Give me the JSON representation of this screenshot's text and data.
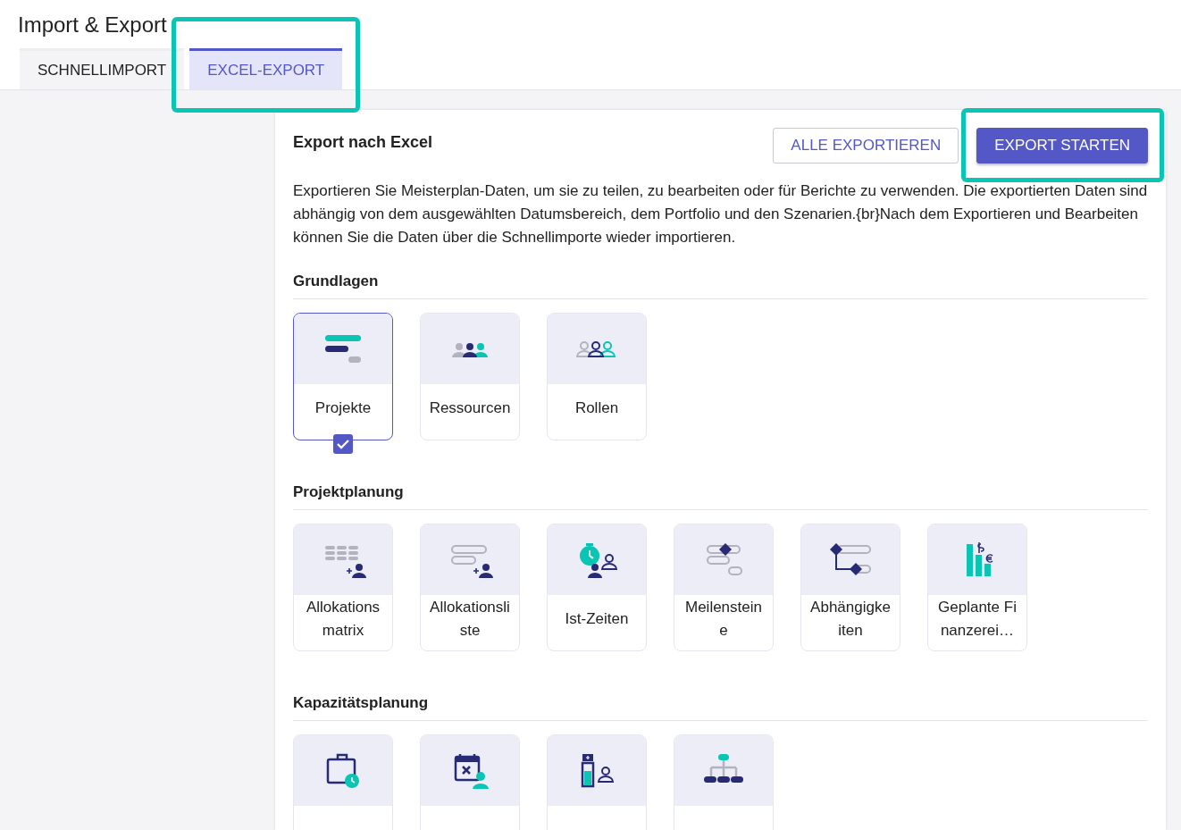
{
  "page_title": "Import & Export",
  "tabs": [
    {
      "label": "SCHNELLIMPORT",
      "selected": false
    },
    {
      "label": "EXCEL-EXPORT",
      "selected": true,
      "highlighted": true
    }
  ],
  "panel": {
    "title": "Export nach Excel",
    "buttons": [
      {
        "label": "ALLE EXPORTIEREN",
        "kind": "outlined"
      },
      {
        "label": "EXPORT STARTEN",
        "kind": "filled",
        "highlighted": true
      }
    ],
    "description": "Exportieren Sie Meisterplan-Daten, um sie zu teilen, zu bearbeiten oder für Berichte zu verwenden. Die exportierten Daten sind abhängig von dem ausgewählten Datumsbereich, dem Portfolio und den Szenarien.{br}Nach dem Exportieren und Bearbeiten können Sie die Daten über die Schnellimporte wieder importieren.",
    "sections": [
      {
        "heading": "Grundlagen",
        "items": [
          {
            "label": "Projekte",
            "selected": true
          },
          {
            "label": "Ressourcen",
            "selected": false
          },
          {
            "label": "Rollen",
            "selected": false
          }
        ]
      },
      {
        "heading": "Projektplanung",
        "items": [
          {
            "label": "Allokationsmatrix",
            "selected": false
          },
          {
            "label": "Allokationsliste",
            "selected": false
          },
          {
            "label": "Ist-Zeiten",
            "selected": false
          },
          {
            "label": "Meilensteine",
            "selected": false
          },
          {
            "label": "Abhängigkeiten",
            "selected": false
          },
          {
            "label": "Geplante Finanzerei…",
            "selected": false
          }
        ]
      },
      {
        "heading": "Kapazitätsplanung",
        "items": [
          {
            "selected": false
          },
          {
            "selected": false
          },
          {
            "selected": false
          },
          {
            "selected": false
          }
        ]
      }
    ]
  }
}
